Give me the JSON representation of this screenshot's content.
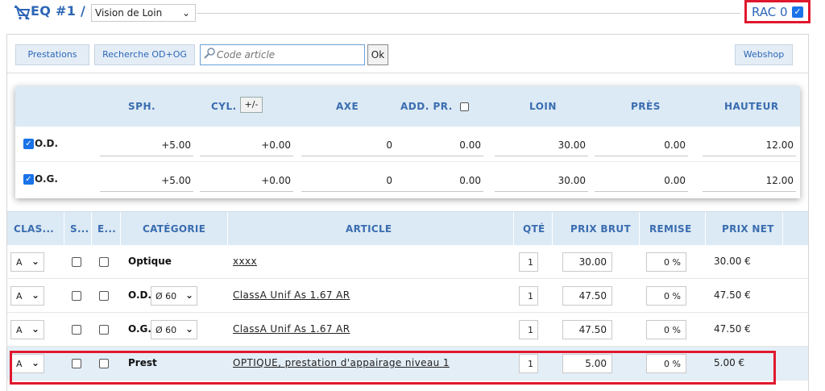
{
  "header": {
    "eq_title": "EQ #1 / 1",
    "vision_select": "Vision de Loin",
    "rac_label": "RAC 0",
    "rac_checked": true
  },
  "toolbar": {
    "prestations": "Prestations",
    "recherche": "Recherche OD+OG",
    "search_placeholder": "Code article",
    "ok": "Ok",
    "webshop": "Webshop"
  },
  "prescription": {
    "headers": {
      "sph": "SPH.",
      "cyl": "CYL.",
      "cyl_toggle": "+/-",
      "axe": "AXE",
      "add": "ADD. PR.",
      "loin": "LOIN",
      "pres": "PRÈS",
      "hauteur": "HAUTEUR"
    },
    "rows": [
      {
        "eye": "O.D.",
        "checked": true,
        "sph": "+5.00",
        "cyl": "+0.00",
        "axe": "0",
        "add": "0.00",
        "loin": "30.00",
        "pres": "0.00",
        "hauteur": "12.00"
      },
      {
        "eye": "O.G.",
        "checked": true,
        "sph": "+5.00",
        "cyl": "+0.00",
        "axe": "0",
        "add": "0.00",
        "loin": "30.00",
        "pres": "0.00",
        "hauteur": "12.00"
      }
    ]
  },
  "lines": {
    "headers": {
      "classe": "CLAS...",
      "s": "S...",
      "e": "E...",
      "categorie": "CATÉGORIE",
      "article": "ARTICLE",
      "qte": "QTÉ",
      "prix_brut": "PRIX BRUT",
      "remise": "REMISE",
      "prix_net": "PRIX NET"
    },
    "rows": [
      {
        "classe": "A",
        "categorie": "Optique",
        "diam": "",
        "article": "xxxx",
        "qte": "1",
        "prix_brut": "30.00",
        "remise": "0 %",
        "prix_net": "30.00 €"
      },
      {
        "classe": "A",
        "categorie": "O.D.",
        "diam": "Ø 60",
        "article": "ClassA Unif As 1.67 AR",
        "qte": "1",
        "prix_brut": "47.50",
        "remise": "0 %",
        "prix_net": "47.50 €"
      },
      {
        "classe": "A",
        "categorie": "O.G.",
        "diam": "Ø 60",
        "article": "ClassA Unif As 1.67 AR",
        "qte": "1",
        "prix_brut": "47.50",
        "remise": "0 %",
        "prix_net": "47.50 €"
      },
      {
        "classe": "A",
        "categorie": "Prest",
        "diam": "",
        "article": "OPTIQUE, prestation d'appairage niveau 1",
        "qte": "1",
        "prix_brut": "5.00",
        "remise": "0 %",
        "prix_net": "5.00 €"
      }
    ]
  },
  "colors": {
    "accent": "#2c66b6",
    "header_bg": "#dceaf5",
    "highlight_border": "#e0182e"
  }
}
